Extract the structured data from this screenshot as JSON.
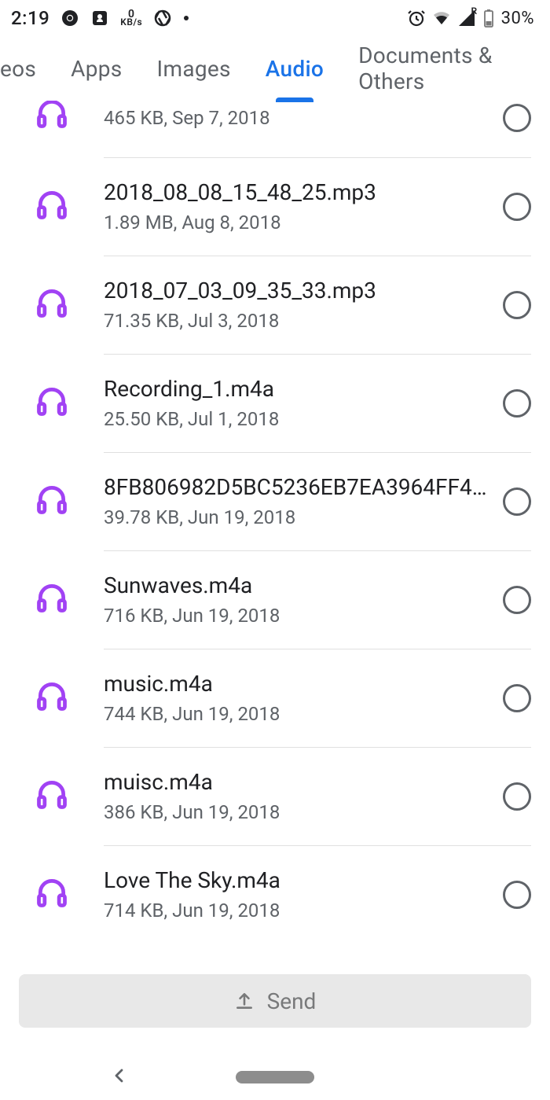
{
  "status": {
    "time": "2:19",
    "net_speed": {
      "value": "0",
      "unit": "KB/s"
    },
    "signal_letter": "R",
    "battery": "30%"
  },
  "tabs": [
    {
      "label": "eos",
      "active": false
    },
    {
      "label": "Apps",
      "active": false
    },
    {
      "label": "Images",
      "active": false
    },
    {
      "label": "Audio",
      "active": true
    },
    {
      "label": "Documents & Others",
      "active": false
    }
  ],
  "files": [
    {
      "name": "",
      "meta": "465 KB, Sep 7, 2018",
      "cutoff": true
    },
    {
      "name": "2018_08_08_15_48_25.mp3",
      "meta": "1.89 MB, Aug 8, 2018"
    },
    {
      "name": "2018_07_03_09_35_33.mp3",
      "meta": "71.35 KB, Jul 3, 2018"
    },
    {
      "name": "Recording_1.m4a",
      "meta": "25.50 KB, Jul 1, 2018"
    },
    {
      "name": "8FB806982D5BC5236EB7EA3964FF4...",
      "meta": "39.78 KB, Jun 19, 2018"
    },
    {
      "name": "Sunwaves.m4a",
      "meta": "716 KB, Jun 19, 2018"
    },
    {
      "name": "music.m4a",
      "meta": "744 KB, Jun 19, 2018"
    },
    {
      "name": "muisc.m4a",
      "meta": "386 KB, Jun 19, 2018"
    },
    {
      "name": "Love The Sky.m4a",
      "meta": "714 KB, Jun 19, 2018"
    }
  ],
  "send_label": "Send",
  "colors": {
    "accent": "#1a73e8",
    "audio_icon": "#a142f4"
  }
}
